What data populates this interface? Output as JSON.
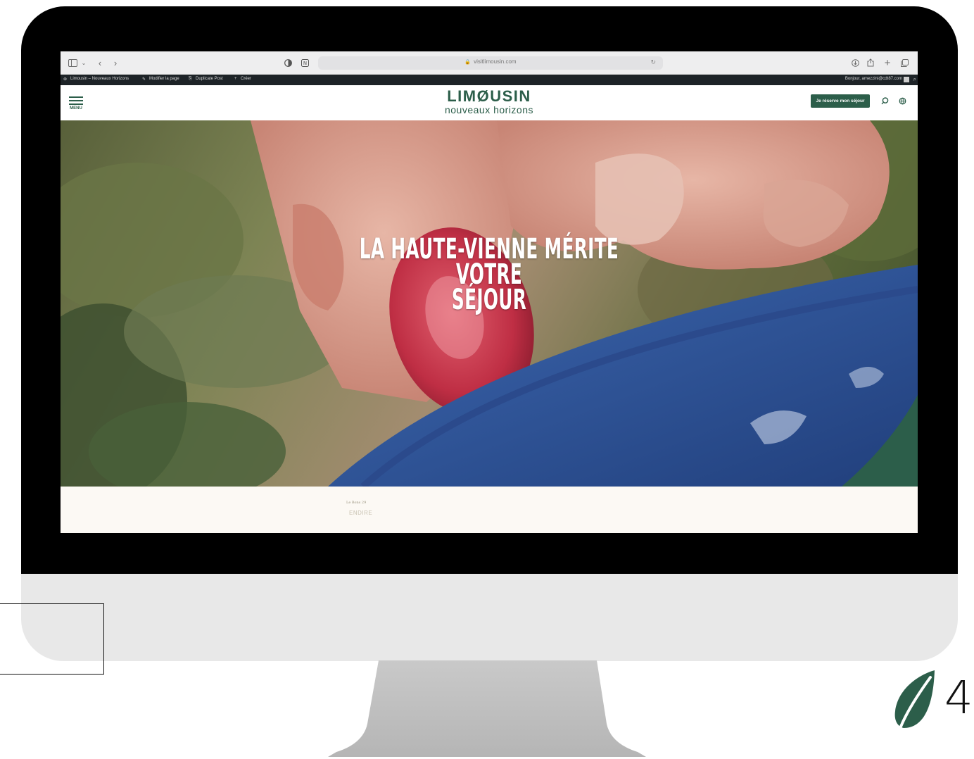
{
  "browser": {
    "url": "visitlimousin.com"
  },
  "admin_bar": {
    "site_name": "Limousin – Nouveaux Horizons",
    "edit_page": "Modifier la page",
    "duplicate": "Duplicate Post",
    "create": "Créer",
    "greeting": "Bonjour, amezzini@cdt87.com"
  },
  "header": {
    "menu_label": "MENU",
    "logo_title": "LIMØUSIN",
    "logo_subtitle": "nouveaux horizons",
    "cta_label": "Je réserve mon séjour",
    "brand_color": "#2c5e4a"
  },
  "hero": {
    "title_line1": "LA HAUTE-VIENNE MÉRITE VOTRE",
    "title_line2": "SÉJOUR"
  },
  "section": {
    "small_text": "Le Bons 29",
    "link_text": "ENDIRE"
  },
  "overlay": {
    "number": "4"
  },
  "icons": [
    "sidebar-icon",
    "chevron-down-icon",
    "back-icon",
    "forward-icon",
    "privacy-icon",
    "extension-icon",
    "lock-icon",
    "reload-icon",
    "download-icon",
    "share-icon",
    "plus-icon",
    "tabs-icon",
    "wordpress-icon",
    "pencil-icon",
    "duplicate-icon",
    "plus-icon",
    "search-icon",
    "hamburger-icon",
    "search-icon",
    "globe-icon",
    "leaf-icon"
  ]
}
